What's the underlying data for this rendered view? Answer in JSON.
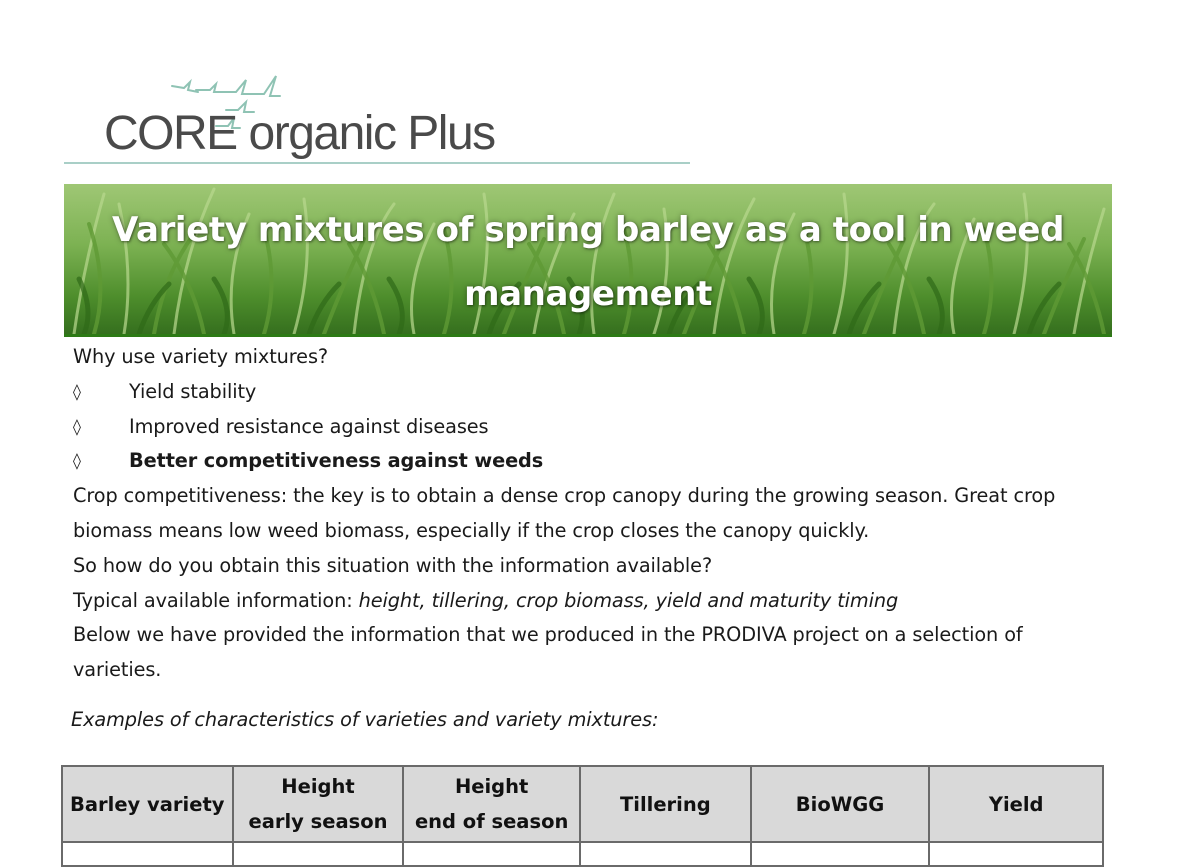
{
  "logo": {
    "text": "CORE organic Plus",
    "line_color": "#a9cfc7",
    "bird_color": "#8fc3b4"
  },
  "banner": {
    "title": "Variety mixtures of spring barley as a tool in weed management"
  },
  "intro": {
    "question": "Why use variety mixtures?",
    "bullet_symbol": "◊",
    "bullets": [
      "Yield stability",
      "Improved resistance against diseases",
      "Better competitiveness against weeds"
    ],
    "para1": "Crop competitiveness: the key is to  obtain a dense crop canopy during the growing season. Great crop biomass means low weed biomass, especially if  the crop closes the canopy  quickly.",
    "para2": "So how do you obtain this situation with the information available?",
    "para3_prefix": "Typical available information: ",
    "para3_italic": "height, tillering, crop biomass, yield and maturity timing",
    "para4": "Below we have provided the information that we produced in the PRODIVA project on a selection of varieties."
  },
  "caption": "Examples of characteristics of varieties and variety mixtures:",
  "table": {
    "header_bg": "#d9d9d9",
    "headers": [
      {
        "line1": "Barley variety",
        "line2": ""
      },
      {
        "line1": "Height",
        "line2": "early season"
      },
      {
        "line1": "Height",
        "line2": "end of season"
      },
      {
        "line1": "Tillering",
        "line2": ""
      },
      {
        "line1": "BioWGG",
        "line2": ""
      },
      {
        "line1": "Yield",
        "line2": ""
      }
    ]
  }
}
